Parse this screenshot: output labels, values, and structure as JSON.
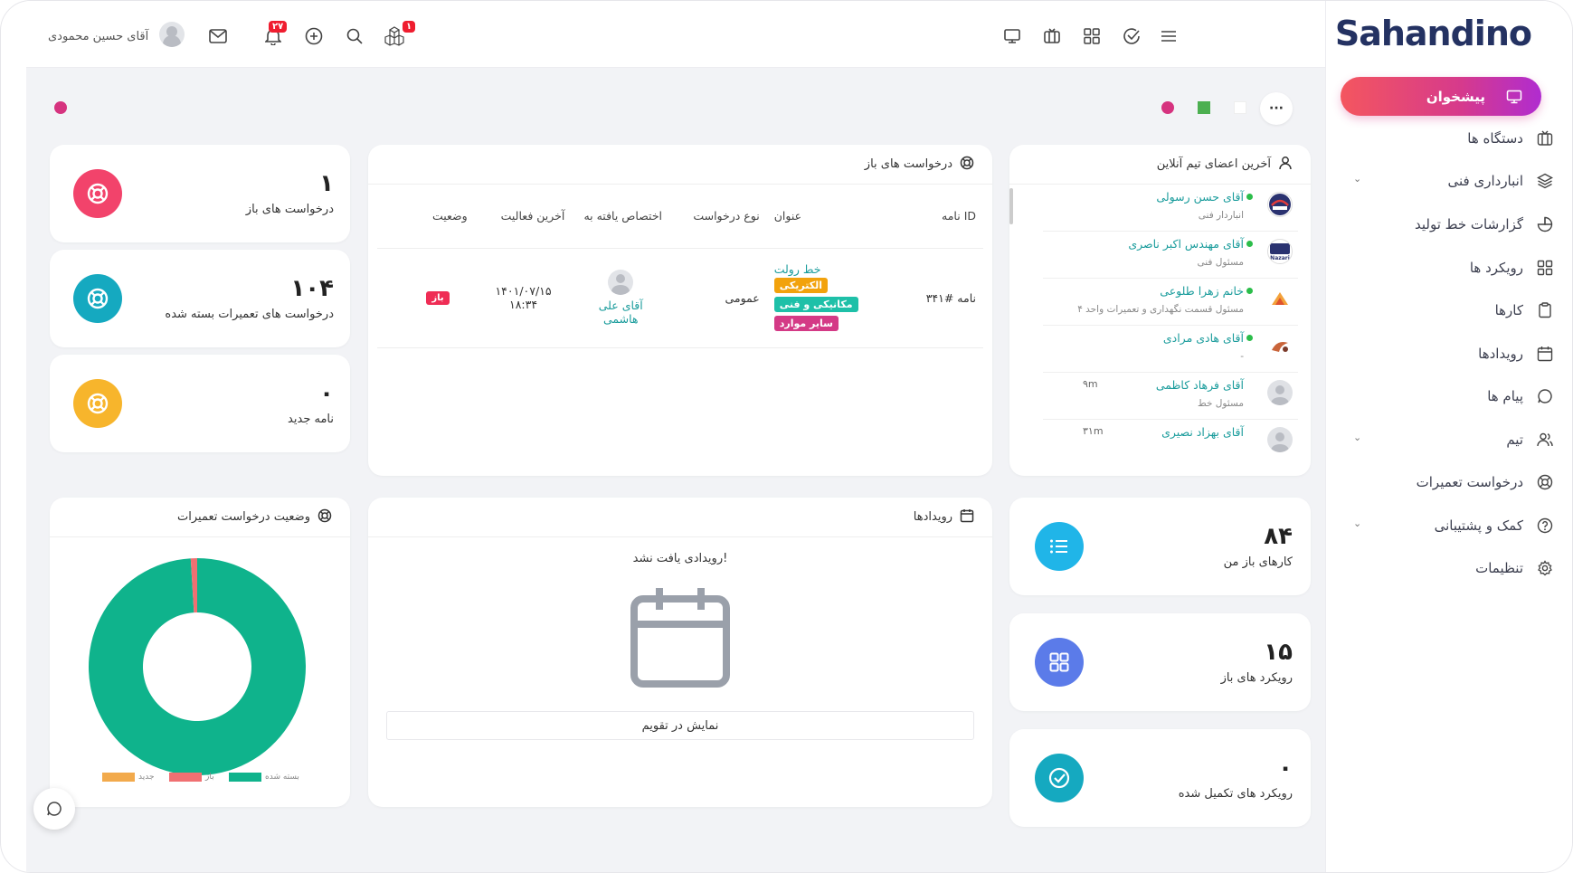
{
  "brand": {
    "logo_text": "Sahandino"
  },
  "topbar": {
    "user_name": "آقای حسین محمودی",
    "notifications_count": "۲۷",
    "boxes_count": "۱",
    "icons": [
      "monitor-icon",
      "tv-icon",
      "grid-icon",
      "check-circle-icon",
      "menu-icon",
      "search-icon",
      "plus-circle-icon",
      "bell-icon",
      "mail-icon",
      "boxes-icon"
    ]
  },
  "sidebar": {
    "active": {
      "label": "پیشخوان",
      "icon": "monitor-icon"
    },
    "items": [
      {
        "label": "دستگاه ها",
        "icon": "tv-icon",
        "expandable": false
      },
      {
        "label": "انبارداری فنی",
        "icon": "layers-icon",
        "expandable": true
      },
      {
        "label": "گزارشات خط تولید",
        "icon": "pie-chart-icon",
        "expandable": false
      },
      {
        "label": "رویکرد ها",
        "icon": "grid-icon",
        "expandable": false
      },
      {
        "label": "کارها",
        "icon": "clipboard-icon",
        "expandable": false
      },
      {
        "label": "رویدادها",
        "icon": "calendar-icon",
        "expandable": false
      },
      {
        "label": "پیام ها",
        "icon": "chat-icon",
        "expandable": false
      },
      {
        "label": "تیم",
        "icon": "users-icon",
        "expandable": true
      },
      {
        "label": "درخواست تعمیرات",
        "icon": "lifebuoy-icon",
        "expandable": false
      },
      {
        "label": "کمک و پشتیبانی",
        "icon": "help-icon",
        "expandable": true
      },
      {
        "label": "تنظیمات",
        "icon": "gear-icon",
        "expandable": false
      }
    ]
  },
  "theme_colors": [
    "#d6337f",
    "#4caf50",
    "#ffffff"
  ],
  "stats_left": [
    {
      "value": "۱",
      "label": "درخواست های باز",
      "color": "#f2436b"
    },
    {
      "value": "۱۰۴",
      "label": "درخواست های تعمیرات بسته شده",
      "color": "#15a9c0"
    },
    {
      "value": "۰",
      "label": "نامه جدید",
      "color": "#f7b52c"
    }
  ],
  "open_requests": {
    "title": "درخواست های باز",
    "columns": [
      "ID نامه",
      "عنوان",
      "نوع درخواست",
      "اختصاص یافته به",
      "آخرین فعالیت",
      "وضعیت"
    ],
    "rows": [
      {
        "id": "نامه #۳۴۱",
        "title": "خط رولت",
        "tags": [
          {
            "text": "الکتریکی",
            "color": "#f2a20c"
          },
          {
            "text": "مکانیکی و فنی",
            "color": "#1ec0a8"
          },
          {
            "text": "سایر موارد",
            "color": "#d43a86"
          }
        ],
        "type": "عمومی",
        "assigned": "آقای علی هاشمی",
        "last_activity_date": "۱۴۰۱/۰۷/۱۵",
        "last_activity_time": "۱۸:۳۴",
        "status": "باز"
      }
    ]
  },
  "team": {
    "title": "آخرین اعضای تیم آنلاین",
    "members": [
      {
        "name": "آقای حسن رسولی",
        "role": "انباردار فنی",
        "status": "",
        "online": true,
        "avatar": "logo-a"
      },
      {
        "name": "آقای مهندس اکبر ناصری",
        "role": "مسئول فنی",
        "status": "",
        "online": true,
        "avatar": "Nazari"
      },
      {
        "name": "خانم زهرا طلوعی",
        "role": "مسئول قسمت نگهداری و تعمیرات واحد ۴",
        "status": "",
        "online": true,
        "avatar": "logo-c"
      },
      {
        "name": "آقای هادی مرادی",
        "role": "-",
        "status": "",
        "online": true,
        "avatar": "logo-d"
      },
      {
        "name": "آقای فرهاد کاظمی",
        "role": "مسئول خط",
        "status": "۹m",
        "online": false,
        "avatar": "default"
      },
      {
        "name": "آقای بهزاد نصیری",
        "role": "",
        "status": "۳۱m",
        "online": false,
        "avatar": "default"
      }
    ]
  },
  "stats_right": [
    {
      "value": "۸۴",
      "label": "کارهای باز من",
      "color": "#20b5e8"
    },
    {
      "value": "۱۵",
      "label": "رویکرد های باز",
      "color": "#5b7be9"
    },
    {
      "value": "۰",
      "label": "رویکرد های تکمیل شده",
      "color": "#15a9c0"
    }
  ],
  "events": {
    "title": "رویدادها",
    "empty_text": "رویدادی یافت نشد!",
    "calendar_button": "نمایش در تقویم"
  },
  "repair_status": {
    "title": "وضعیت درخواست تعمیرات"
  },
  "chart_data": {
    "type": "pie",
    "title": "وضعیت درخواست تعمیرات",
    "categories": [
      "بسته شده",
      "باز",
      "جدید"
    ],
    "values": [
      104,
      1,
      0
    ],
    "colors": [
      "#0fb38c",
      "#f07072",
      "#f2aa4c"
    ]
  }
}
